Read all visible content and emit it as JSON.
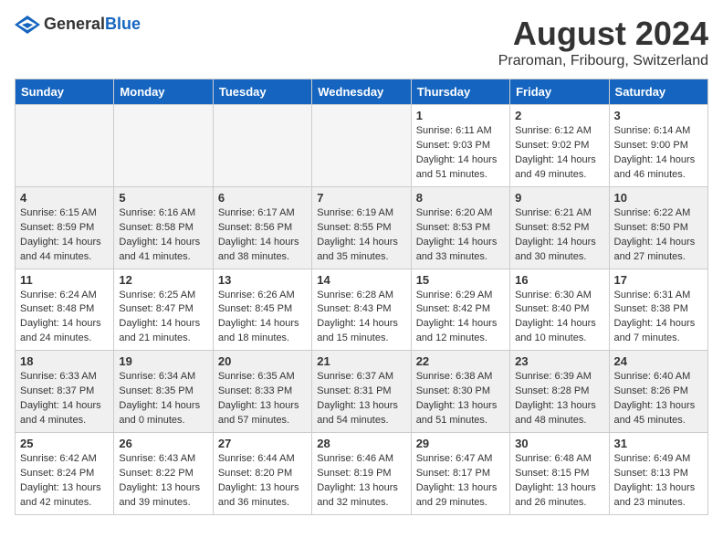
{
  "logo": {
    "general": "General",
    "blue": "Blue"
  },
  "title": "August 2024",
  "location": "Praroman, Fribourg, Switzerland",
  "days_of_week": [
    "Sunday",
    "Monday",
    "Tuesday",
    "Wednesday",
    "Thursday",
    "Friday",
    "Saturday"
  ],
  "weeks": [
    [
      {
        "num": "",
        "info": ""
      },
      {
        "num": "",
        "info": ""
      },
      {
        "num": "",
        "info": ""
      },
      {
        "num": "",
        "info": ""
      },
      {
        "num": "1",
        "info": "Sunrise: 6:11 AM\nSunset: 9:03 PM\nDaylight: 14 hours\nand 51 minutes."
      },
      {
        "num": "2",
        "info": "Sunrise: 6:12 AM\nSunset: 9:02 PM\nDaylight: 14 hours\nand 49 minutes."
      },
      {
        "num": "3",
        "info": "Sunrise: 6:14 AM\nSunset: 9:00 PM\nDaylight: 14 hours\nand 46 minutes."
      }
    ],
    [
      {
        "num": "4",
        "info": "Sunrise: 6:15 AM\nSunset: 8:59 PM\nDaylight: 14 hours\nand 44 minutes."
      },
      {
        "num": "5",
        "info": "Sunrise: 6:16 AM\nSunset: 8:58 PM\nDaylight: 14 hours\nand 41 minutes."
      },
      {
        "num": "6",
        "info": "Sunrise: 6:17 AM\nSunset: 8:56 PM\nDaylight: 14 hours\nand 38 minutes."
      },
      {
        "num": "7",
        "info": "Sunrise: 6:19 AM\nSunset: 8:55 PM\nDaylight: 14 hours\nand 35 minutes."
      },
      {
        "num": "8",
        "info": "Sunrise: 6:20 AM\nSunset: 8:53 PM\nDaylight: 14 hours\nand 33 minutes."
      },
      {
        "num": "9",
        "info": "Sunrise: 6:21 AM\nSunset: 8:52 PM\nDaylight: 14 hours\nand 30 minutes."
      },
      {
        "num": "10",
        "info": "Sunrise: 6:22 AM\nSunset: 8:50 PM\nDaylight: 14 hours\nand 27 minutes."
      }
    ],
    [
      {
        "num": "11",
        "info": "Sunrise: 6:24 AM\nSunset: 8:48 PM\nDaylight: 14 hours\nand 24 minutes."
      },
      {
        "num": "12",
        "info": "Sunrise: 6:25 AM\nSunset: 8:47 PM\nDaylight: 14 hours\nand 21 minutes."
      },
      {
        "num": "13",
        "info": "Sunrise: 6:26 AM\nSunset: 8:45 PM\nDaylight: 14 hours\nand 18 minutes."
      },
      {
        "num": "14",
        "info": "Sunrise: 6:28 AM\nSunset: 8:43 PM\nDaylight: 14 hours\nand 15 minutes."
      },
      {
        "num": "15",
        "info": "Sunrise: 6:29 AM\nSunset: 8:42 PM\nDaylight: 14 hours\nand 12 minutes."
      },
      {
        "num": "16",
        "info": "Sunrise: 6:30 AM\nSunset: 8:40 PM\nDaylight: 14 hours\nand 10 minutes."
      },
      {
        "num": "17",
        "info": "Sunrise: 6:31 AM\nSunset: 8:38 PM\nDaylight: 14 hours\nand 7 minutes."
      }
    ],
    [
      {
        "num": "18",
        "info": "Sunrise: 6:33 AM\nSunset: 8:37 PM\nDaylight: 14 hours\nand 4 minutes."
      },
      {
        "num": "19",
        "info": "Sunrise: 6:34 AM\nSunset: 8:35 PM\nDaylight: 14 hours\nand 0 minutes."
      },
      {
        "num": "20",
        "info": "Sunrise: 6:35 AM\nSunset: 8:33 PM\nDaylight: 13 hours\nand 57 minutes."
      },
      {
        "num": "21",
        "info": "Sunrise: 6:37 AM\nSunset: 8:31 PM\nDaylight: 13 hours\nand 54 minutes."
      },
      {
        "num": "22",
        "info": "Sunrise: 6:38 AM\nSunset: 8:30 PM\nDaylight: 13 hours\nand 51 minutes."
      },
      {
        "num": "23",
        "info": "Sunrise: 6:39 AM\nSunset: 8:28 PM\nDaylight: 13 hours\nand 48 minutes."
      },
      {
        "num": "24",
        "info": "Sunrise: 6:40 AM\nSunset: 8:26 PM\nDaylight: 13 hours\nand 45 minutes."
      }
    ],
    [
      {
        "num": "25",
        "info": "Sunrise: 6:42 AM\nSunset: 8:24 PM\nDaylight: 13 hours\nand 42 minutes."
      },
      {
        "num": "26",
        "info": "Sunrise: 6:43 AM\nSunset: 8:22 PM\nDaylight: 13 hours\nand 39 minutes."
      },
      {
        "num": "27",
        "info": "Sunrise: 6:44 AM\nSunset: 8:20 PM\nDaylight: 13 hours\nand 36 minutes."
      },
      {
        "num": "28",
        "info": "Sunrise: 6:46 AM\nSunset: 8:19 PM\nDaylight: 13 hours\nand 32 minutes."
      },
      {
        "num": "29",
        "info": "Sunrise: 6:47 AM\nSunset: 8:17 PM\nDaylight: 13 hours\nand 29 minutes."
      },
      {
        "num": "30",
        "info": "Sunrise: 6:48 AM\nSunset: 8:15 PM\nDaylight: 13 hours\nand 26 minutes."
      },
      {
        "num": "31",
        "info": "Sunrise: 6:49 AM\nSunset: 8:13 PM\nDaylight: 13 hours\nand 23 minutes."
      }
    ]
  ]
}
